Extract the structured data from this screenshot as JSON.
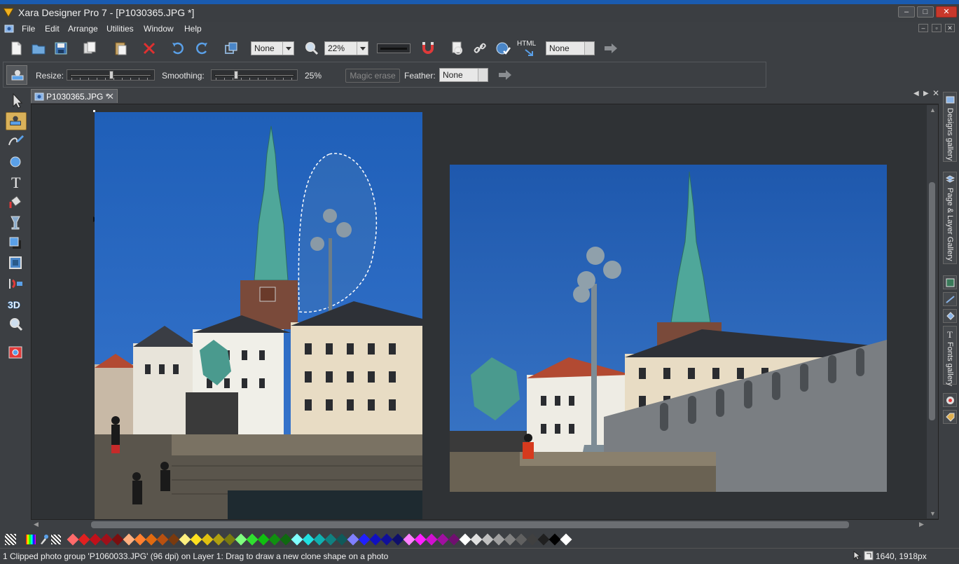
{
  "window": {
    "title": "Xara Designer Pro 7 - [P1030365.JPG *]",
    "min_label": "–",
    "max_label": "□",
    "close_label": "✕"
  },
  "menu": {
    "items": [
      "File",
      "Edit",
      "Arrange",
      "Utilities",
      "Window",
      "Help"
    ]
  },
  "toolbar": {
    "layer_select": "None",
    "zoom": "22%",
    "html_label": "HTML",
    "link_select": "None"
  },
  "infobar": {
    "resize_label": "Resize:",
    "smoothing_label": "Smoothing:",
    "smoothing_value": "25%",
    "smoothing_level": 0.25,
    "resize_level": 0.5,
    "magic_erase_label": "Magic erase",
    "feather_label": "Feather:",
    "feather_value": "None"
  },
  "document_tab": {
    "label": "P1030365.JPG *",
    "close": "✕"
  },
  "galleries": {
    "designs": "Designs gallery",
    "page_layer": "Page & Layer Gallery",
    "fonts": "Fonts gallery"
  },
  "toolbox": {
    "tools": [
      "selector-tool",
      "clone-tool",
      "freehand-tool",
      "shape-tool",
      "text-tool",
      "fill-tool",
      "transparency-tool",
      "shadow-tool",
      "bevel-tool",
      "contour-tool",
      "extrude-3d-tool",
      "zoom-tool",
      "photo-tool"
    ],
    "three_d_label": "3D"
  },
  "palette": {
    "colors": [
      "#ff6b6b",
      "#e02020",
      "#c0101a",
      "#a0101a",
      "#7a0f10",
      "#ffb080",
      "#ff8030",
      "#e06a10",
      "#b85010",
      "#7a3a0f",
      "#fff080",
      "#ffe020",
      "#e0c010",
      "#b0a010",
      "#7a7a10",
      "#80ff80",
      "#30e030",
      "#10c010",
      "#109010",
      "#0f6a10",
      "#80ffff",
      "#20e0e0",
      "#10b0b0",
      "#108080",
      "#0f5a5a",
      "#8080ff",
      "#2020ff",
      "#1010c0",
      "#10109a",
      "#0f0f6a",
      "#ff80ff",
      "#ff20ff",
      "#d010d0",
      "#a010a0",
      "#700f70",
      "#ffffff",
      "#e0e0e0",
      "#c0c0c0",
      "#a0a0a0",
      "#808080",
      "#606060",
      "#404040",
      "#202020",
      "#000000",
      "#ffffff"
    ]
  },
  "status": {
    "message": "1 Clipped photo group 'P1060033.JPG' (96 dpi) on Layer 1: Drag to draw a new clone shape on a photo",
    "coords": "1640, 1918px"
  }
}
